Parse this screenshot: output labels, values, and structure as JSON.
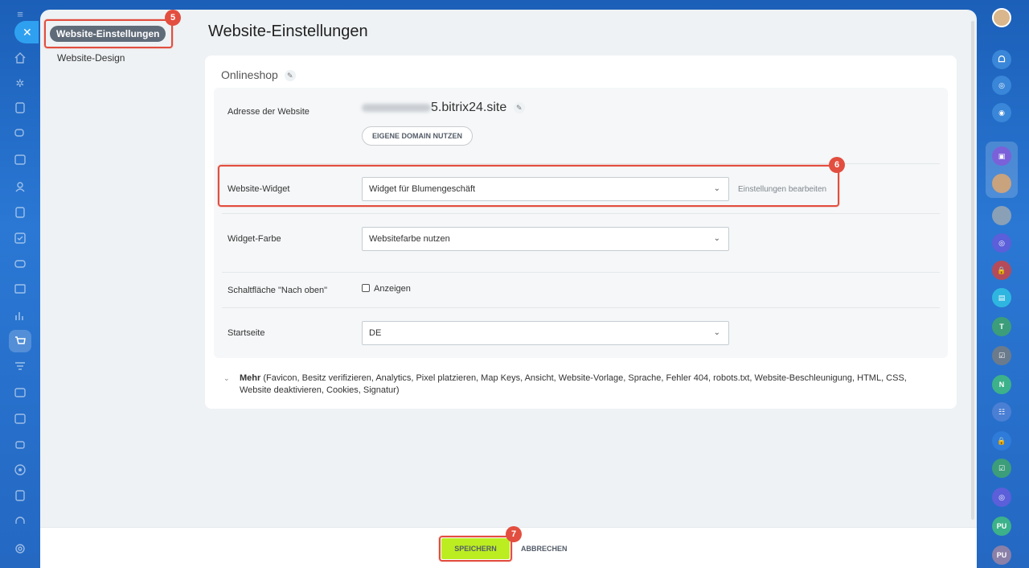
{
  "sidebar": {
    "items": [
      {
        "label": "Website-Einstellungen"
      },
      {
        "label": "Website-Design"
      }
    ]
  },
  "page": {
    "title": "Website-Einstellungen",
    "section_title": "Onlineshop"
  },
  "site_address": {
    "label": "Adresse der Website",
    "domain_suffix": "5.bitrix24.site",
    "own_domain_button": "EIGENE DOMAIN NUTZEN"
  },
  "widget": {
    "label": "Website-Widget",
    "value": "Widget für Blumengeschäft",
    "edit_link": "Einstellungen bearbeiten"
  },
  "widget_color": {
    "label": "Widget-Farbe",
    "value": "Websitefarbe nutzen"
  },
  "back_to_top": {
    "label": "Schaltfläche \"Nach oben\"",
    "checkbox_label": "Anzeigen",
    "checked": false
  },
  "start_page": {
    "label": "Startseite",
    "value": "DE"
  },
  "more": {
    "title": "Mehr",
    "details": "(Favicon, Besitz verifizieren, Analytics, Pixel platzieren, Map Keys, Ansicht, Website-Vorlage, Sprache, Fehler 404, robots.txt, Website-Beschleunigung, HTML, CSS, Website deaktivieren, Cookies, Signatur)"
  },
  "footer": {
    "save_label": "SPEICHERN",
    "cancel_label": "ABBRECHEN"
  },
  "annotations": {
    "step5": "5",
    "step6": "6",
    "step7": "7"
  },
  "right_rail": {
    "avatar_t": "T",
    "avatar_n": "N",
    "avatar_pu1": "PU",
    "avatar_pu2": "PU"
  },
  "colors": {
    "accent_red": "#e24e3f",
    "save_green": "#bbed21",
    "close_blue": "#2fa0f0"
  }
}
